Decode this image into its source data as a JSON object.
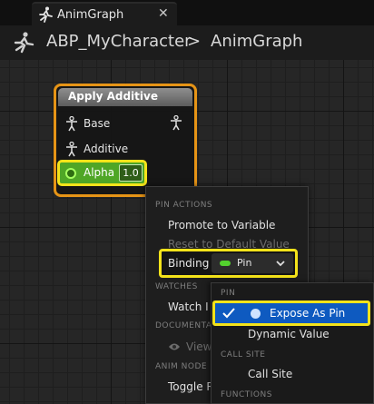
{
  "tab": {
    "label": "AnimGraph",
    "close": "✕"
  },
  "breadcrumb": {
    "root": "ABP_MyCharacter",
    "separator": ">",
    "current": "AnimGraph"
  },
  "node": {
    "title": "Apply Additive",
    "pins": [
      {
        "label": "Base"
      },
      {
        "label": "Additive"
      }
    ],
    "alpha": {
      "label": "Alpha",
      "value": "1.0"
    }
  },
  "context_menu": {
    "sections": [
      {
        "header": "PIN ACTIONS",
        "items": [
          {
            "label": "Promote to Variable",
            "enabled": true
          },
          {
            "label": "Reset to Default Value",
            "enabled": false
          }
        ]
      },
      {
        "header": "WATCHES",
        "items": [
          {
            "label": "Watch I"
          }
        ]
      },
      {
        "header": "DOCUMENTA",
        "items": [
          {
            "label": "View"
          }
        ]
      },
      {
        "header": "ANIM NODE",
        "items": [
          {
            "label": "Toggle R"
          }
        ]
      }
    ],
    "binding": {
      "label": "Binding",
      "value": "Pin",
      "swatch_color": "#53d12e"
    }
  },
  "submenu": {
    "sections": [
      {
        "header": "PIN",
        "items": [
          {
            "label": "Expose As Pin",
            "checked": true,
            "selected": true
          },
          {
            "label": "Dynamic Value"
          }
        ]
      },
      {
        "header": "CALL SITE",
        "items": [
          {
            "label": "Call Site"
          }
        ]
      },
      {
        "header": "FUNCTIONS",
        "items": []
      }
    ]
  },
  "colors": {
    "highlight": "#f4e31a",
    "node_border": "#e69416",
    "selection": "#0e5ac0",
    "float_pin": "#4fa626"
  }
}
